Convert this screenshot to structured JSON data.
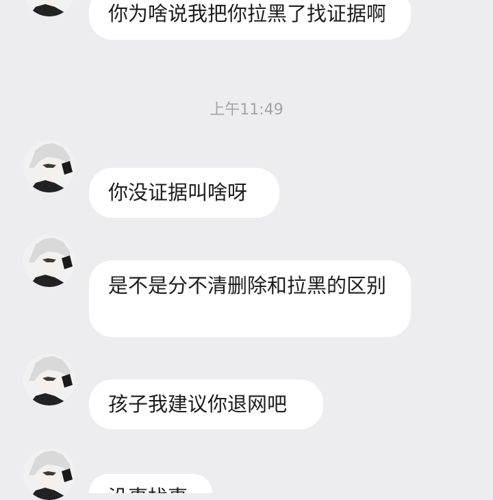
{
  "timestamp": "上午11:49",
  "messages": [
    {
      "text": "你为啥说我把你拉黑了找证据啊"
    },
    {
      "text": "你没证据叫啥呀"
    },
    {
      "text": "是不是分不清删除和拉黑的区别"
    },
    {
      "text": "孩子我建议你退网吧"
    },
    {
      "text": "没事找事"
    }
  ],
  "colors": {
    "background": "#ededf0",
    "bubble": "#ffffff",
    "text": "#1c1c1c",
    "timestamp": "#a3a3a7"
  }
}
